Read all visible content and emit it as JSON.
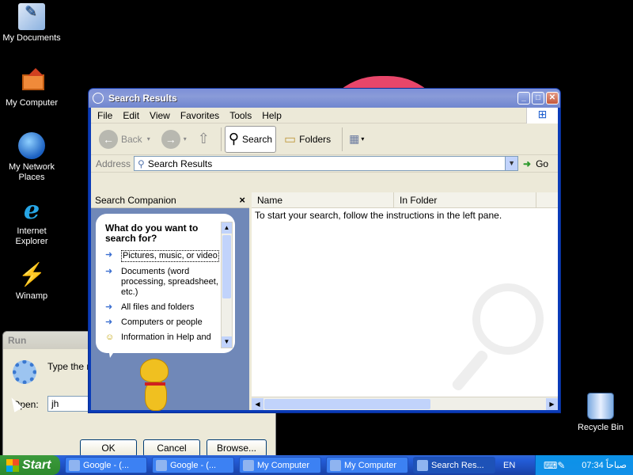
{
  "desktop": {
    "icons": [
      {
        "label": "My Documents",
        "icon": "my-documents-icon"
      },
      {
        "label": "My Computer",
        "icon": "my-computer-icon"
      },
      {
        "label": "My Network Places",
        "icon": "network-places-icon"
      },
      {
        "label": "Internet Explorer",
        "icon": "internet-explorer-icon"
      },
      {
        "label": "Winamp",
        "icon": "winamp-icon"
      },
      {
        "label": "Recycle Bin",
        "icon": "recycle-bin-icon"
      }
    ]
  },
  "search_window": {
    "title": "Search Results",
    "menu": [
      "File",
      "Edit",
      "View",
      "Favorites",
      "Tools",
      "Help"
    ],
    "toolbar": {
      "back": "Back",
      "search": "Search",
      "folders": "Folders"
    },
    "address": {
      "label": "Address",
      "value": "Search Results",
      "go": "Go"
    },
    "companion": {
      "title": "Search Companion",
      "close": "×",
      "question": "What do you want to search for?",
      "options": [
        "Pictures, music, or video",
        "Documents (word processing, spreadsheet, etc.)",
        "All files and folders",
        "Computers or people",
        "Information in Help and Support Center"
      ]
    },
    "columns": [
      "Name",
      "In Folder"
    ],
    "hint": "To start your search, follow the instructions in the left pane."
  },
  "run_dialog": {
    "title": "Run",
    "description": "Type the n... Internet re...",
    "open_label": "Open:",
    "open_value": "jh",
    "ok": "OK",
    "cancel": "Cancel",
    "browse": "Browse..."
  },
  "taskbar": {
    "start": "Start",
    "tasks": [
      "Google - (...",
      "Google - (...",
      "My Computer",
      "My Computer",
      "Search Res..."
    ],
    "active_task_index": 4,
    "language": "EN",
    "clock": "07:34 صباحاً"
  }
}
